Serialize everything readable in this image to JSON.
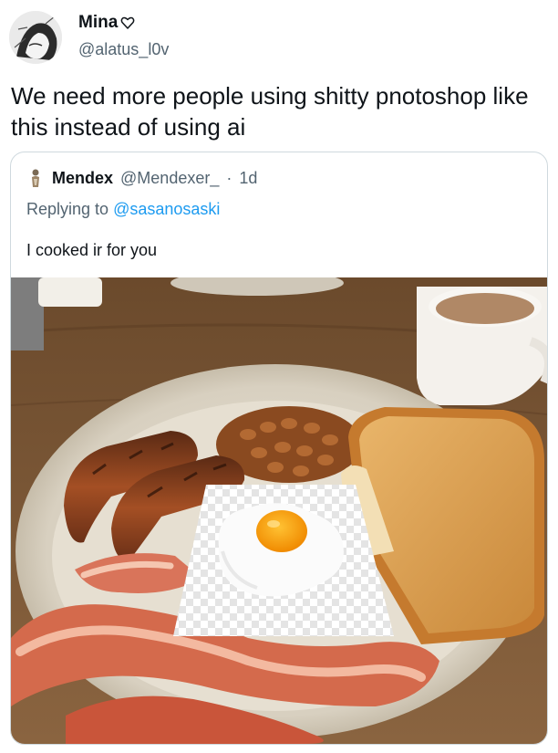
{
  "tweet": {
    "display_name": "Mina",
    "handle": "@alatus_l0v",
    "text": "We need more people using shitty pnotoshop like this instead of using ai"
  },
  "quoted_tweet": {
    "display_name": "Mendex",
    "handle": "@Mendexer_",
    "separator": "·",
    "time": "1d",
    "replying_prefix": "Replying to",
    "replying_to": "@sasanosaski",
    "text": "I cooked ir for you"
  },
  "icons": {
    "heart": "heart-outline-icon",
    "avatar": "avatar-sketch",
    "quote_avatar": "avatar-figure"
  },
  "colors": {
    "text_primary": "#0f1419",
    "text_secondary": "#536471",
    "border": "#cfd9de"
  }
}
